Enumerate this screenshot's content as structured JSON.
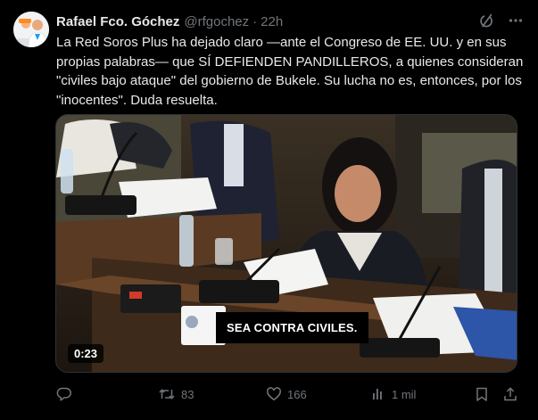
{
  "tweet": {
    "author_name": "Rafael Fco. Góchez",
    "handle": "@rfgochez",
    "separator": "·",
    "time": "22h",
    "text": "La Red Soros Plus ha dejado claro —ante el Congreso de EE. UU. y en sus propias palabras— que SÍ DEFIENDEN PANDILLEROS, a quienes consideran \"civiles bajo ataque\" del gobierno de Bukele. Su lucha no es, entonces, por los \"inocentes\". Duda resuelta."
  },
  "media": {
    "caption": "SEA CONTRA CIVILES.",
    "duration": "0:23"
  },
  "actions": {
    "reply_count": "",
    "retweet_count": "83",
    "like_count": "166",
    "views_count": "1 mil"
  },
  "icons": {
    "header": [
      "grok-icon",
      "more-icon"
    ],
    "actions": [
      "reply-icon",
      "retweet-icon",
      "like-icon",
      "views-icon",
      "bookmark-icon",
      "share-icon"
    ]
  },
  "colors": {
    "background": "#000000",
    "text": "#e7e9ea",
    "muted": "#71767b"
  }
}
